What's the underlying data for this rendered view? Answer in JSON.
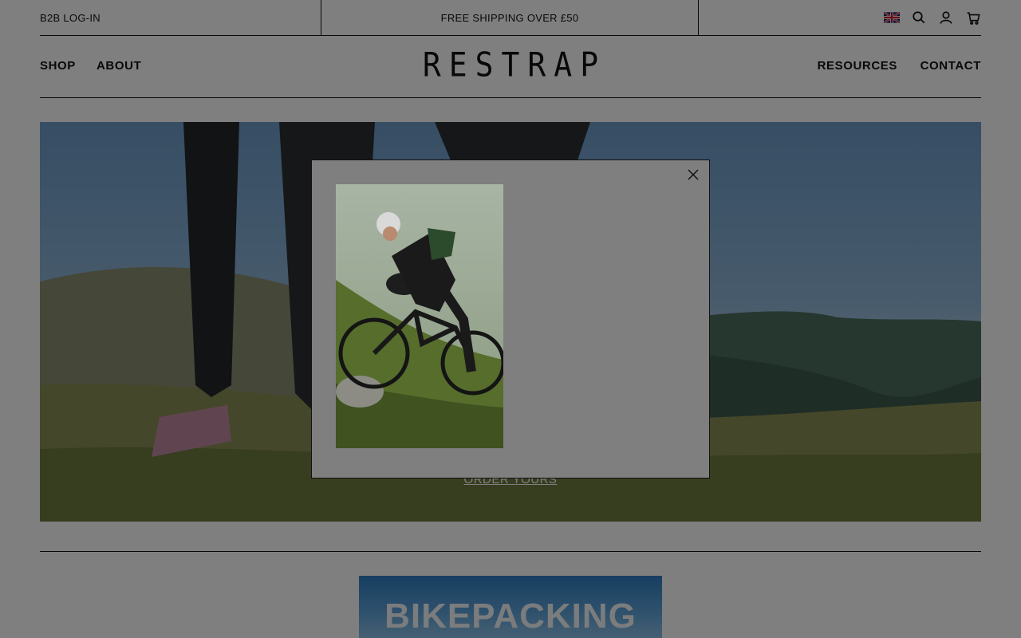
{
  "topbar": {
    "b2b_login": "B2B LOG-IN",
    "announcement": "FREE SHIPPING OVER £50",
    "icons": [
      "uk-flag-icon",
      "search-icon",
      "account-icon",
      "cart-icon"
    ]
  },
  "nav": {
    "left": [
      "SHOP",
      "ABOUT"
    ],
    "right": [
      "RESOURCES",
      "CONTACT"
    ],
    "logo": "RESTRAP"
  },
  "hero": {
    "cta_link": "ORDER YOURS"
  },
  "promo": {
    "title": "BIKEPACKING"
  },
  "modal": {
    "close_icon": "close-icon",
    "image": "cyclist-on-bikepacking-bike"
  },
  "colors": {
    "overlay": "#000000",
    "overlay_opacity": 0.5,
    "text": "#111111",
    "modal_bg": "#ffffff"
  }
}
